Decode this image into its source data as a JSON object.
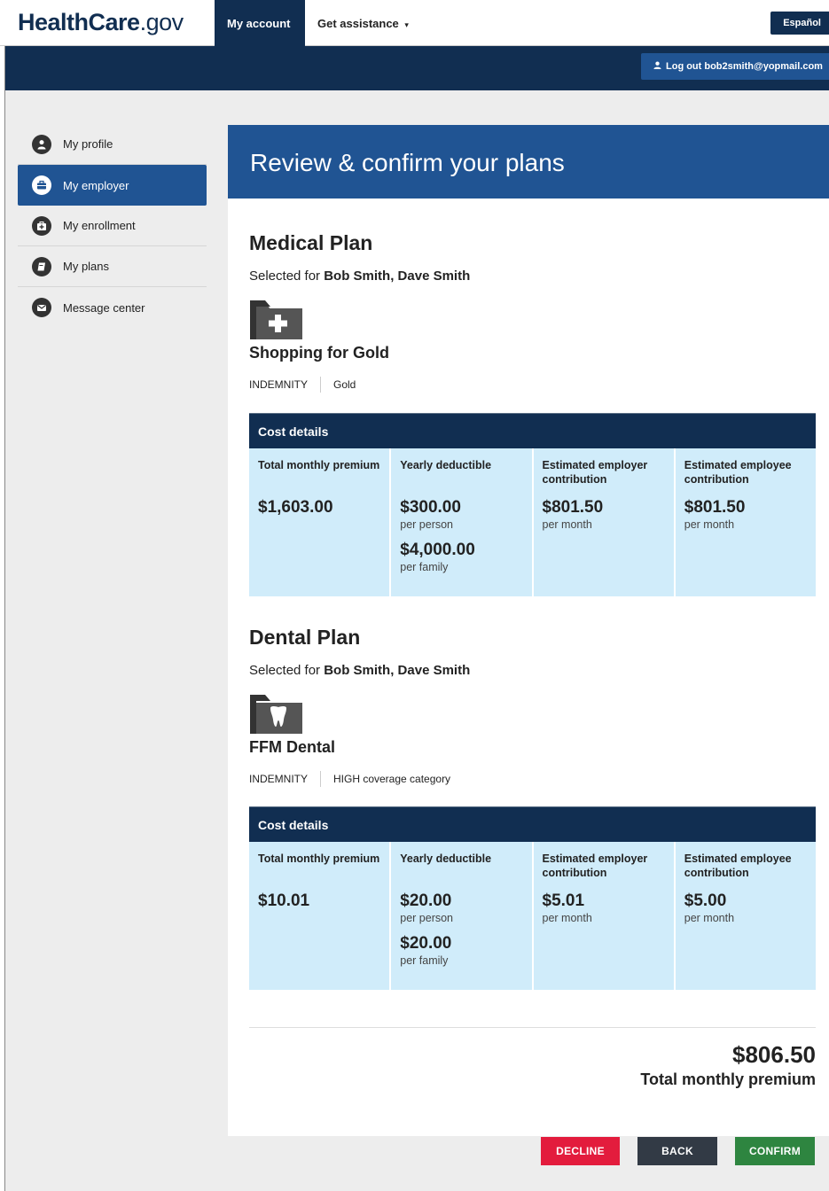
{
  "header": {
    "logo_health": "Health",
    "logo_care": "Care",
    "logo_gov": ".gov",
    "nav_my_account": "My account",
    "nav_get_assistance": "Get assistance",
    "language_button": "Español",
    "logout_button": "Log out bob2smith@yopmail.com"
  },
  "sidebar": {
    "items": [
      {
        "label": "My profile",
        "icon": "person-icon",
        "active": false
      },
      {
        "label": "My employer",
        "icon": "briefcase-icon",
        "active": true
      },
      {
        "label": "My enrollment",
        "icon": "medical-kit-icon",
        "active": false
      },
      {
        "label": "My plans",
        "icon": "book-icon",
        "active": false
      },
      {
        "label": "Message center",
        "icon": "envelope-icon",
        "active": false
      }
    ]
  },
  "page": {
    "title": "Review & confirm your plans"
  },
  "medical": {
    "section_title": "Medical Plan",
    "selected_prefix": "Selected for",
    "selected_names": "Bob Smith, Dave Smith",
    "plan_name": "Shopping for Gold",
    "plan_type": "INDEMNITY",
    "plan_level": "Gold",
    "cost_title": "Cost details",
    "columns": {
      "premium_label": "Total monthly premium",
      "premium_value": "$1,603.00",
      "deductible_label": "Yearly deductible",
      "deductible_person": "$300.00",
      "deductible_person_unit": "per person",
      "deductible_family": "$4,000.00",
      "deductible_family_unit": "per family",
      "employer_label": "Estimated employer contribution",
      "employer_value": "$801.50",
      "employer_unit": "per month",
      "employee_label": "Estimated employee contribution",
      "employee_value": "$801.50",
      "employee_unit": "per month"
    }
  },
  "dental": {
    "section_title": "Dental Plan",
    "selected_prefix": "Selected for",
    "selected_names": "Bob Smith, Dave Smith",
    "plan_name": "FFM Dental",
    "plan_type": "INDEMNITY",
    "plan_level": "HIGH coverage category",
    "cost_title": "Cost details",
    "columns": {
      "premium_label": "Total monthly premium",
      "premium_value": "$10.01",
      "deductible_label": "Yearly deductible",
      "deductible_person": "$20.00",
      "deductible_person_unit": "per person",
      "deductible_family": "$20.00",
      "deductible_family_unit": "per family",
      "employer_label": "Estimated employer contribution",
      "employer_value": "$5.01",
      "employer_unit": "per month",
      "employee_label": "Estimated employee contribution",
      "employee_value": "$5.00",
      "employee_unit": "per month"
    }
  },
  "total": {
    "amount": "$806.50",
    "label": "Total monthly premium"
  },
  "actions": {
    "decline": "DECLINE",
    "back": "BACK",
    "confirm": "CONFIRM"
  },
  "colors": {
    "primary_dark": "#112e51",
    "primary": "#205493",
    "table_bg": "#d0ecfa",
    "decline": "#e31c3d",
    "back": "#323a45",
    "confirm": "#2e8540"
  }
}
